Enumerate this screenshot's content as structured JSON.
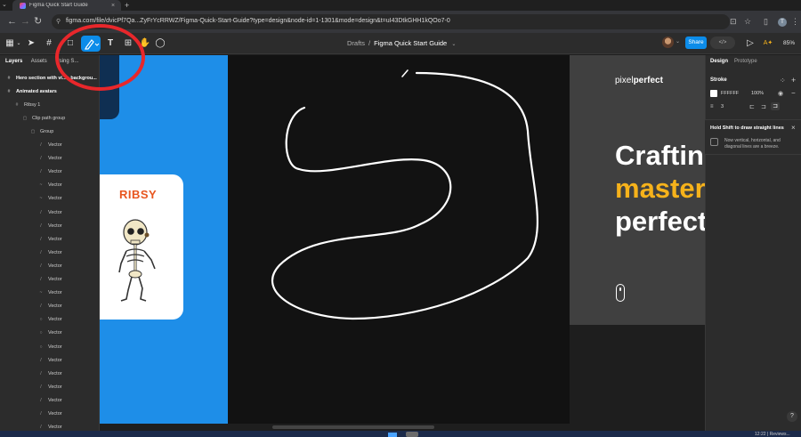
{
  "browser": {
    "tab_title": "Figma Quick Start Guide",
    "url": "figma.com/file/dvicPf7Qa...ZyFrYcRRWZ/Figma-Quick-Start-Guide?type=design&node-id=1-1301&mode=design&t=uI43DtkGHH1kQOo7-0",
    "profile_initial": "T"
  },
  "toolbar": {
    "drafts": "Drafts",
    "separator": "/",
    "file_name": "Figma Quick Start Guide",
    "share_label": "Share",
    "devmode_label": "</>",
    "zoom": "85%"
  },
  "left_panel": {
    "tabs": [
      "Layers",
      "Assets",
      "Using S..."
    ],
    "layers": [
      {
        "label": "Hero section with vi...o backgrou...",
        "indent": 0,
        "bold": true,
        "icon": "#"
      },
      {
        "label": "Animated avatars",
        "indent": 0,
        "bold": true,
        "icon": "#"
      },
      {
        "label": "Ribsy 1",
        "indent": 1,
        "bold": false,
        "icon": "#"
      },
      {
        "label": "Clip path group",
        "indent": 2,
        "bold": false,
        "icon": "▢"
      },
      {
        "label": "Group",
        "indent": 3,
        "bold": false,
        "icon": "▢"
      },
      {
        "label": "Vector",
        "indent": 4,
        "bold": false,
        "icon": "/"
      },
      {
        "label": "Vector",
        "indent": 4,
        "bold": false,
        "icon": "/"
      },
      {
        "label": "Vector",
        "indent": 4,
        "bold": false,
        "icon": "/"
      },
      {
        "label": "Vector",
        "indent": 4,
        "bold": false,
        "icon": "~"
      },
      {
        "label": "Vector",
        "indent": 4,
        "bold": false,
        "icon": "~"
      },
      {
        "label": "Vector",
        "indent": 4,
        "bold": false,
        "icon": "/"
      },
      {
        "label": "Vector",
        "indent": 4,
        "bold": false,
        "icon": "/"
      },
      {
        "label": "Vector",
        "indent": 4,
        "bold": false,
        "icon": "/"
      },
      {
        "label": "Vector",
        "indent": 4,
        "bold": false,
        "icon": "/"
      },
      {
        "label": "Vector",
        "indent": 4,
        "bold": false,
        "icon": "/"
      },
      {
        "label": "Vector",
        "indent": 4,
        "bold": false,
        "icon": "/"
      },
      {
        "label": "Vector",
        "indent": 4,
        "bold": false,
        "icon": "~"
      },
      {
        "label": "Vector",
        "indent": 4,
        "bold": false,
        "icon": "/"
      },
      {
        "label": "Vector",
        "indent": 4,
        "bold": false,
        "icon": "○"
      },
      {
        "label": "Vector",
        "indent": 4,
        "bold": false,
        "icon": "○"
      },
      {
        "label": "Vector",
        "indent": 4,
        "bold": false,
        "icon": "○"
      },
      {
        "label": "Vector",
        "indent": 4,
        "bold": false,
        "icon": "/"
      },
      {
        "label": "Vector",
        "indent": 4,
        "bold": false,
        "icon": "/"
      },
      {
        "label": "Vector",
        "indent": 4,
        "bold": false,
        "icon": "/"
      },
      {
        "label": "Vector",
        "indent": 4,
        "bold": false,
        "icon": "/"
      },
      {
        "label": "Vector",
        "indent": 4,
        "bold": false,
        "icon": "/"
      },
      {
        "label": "Vector",
        "indent": 4,
        "bold": false,
        "icon": "/"
      }
    ]
  },
  "canvas": {
    "card_title": "RIBSY",
    "brand_light": "pixel",
    "brand_bold": "perfect",
    "headline_1": "Crafting",
    "headline_2": "mastery",
    "headline_3": "perfection"
  },
  "right_panel": {
    "tab_design": "Design",
    "tab_prototype": "Prototype",
    "stroke_title": "Stroke",
    "stroke_hex": "FFFFFF",
    "stroke_opacity": "100%",
    "stroke_weight": "3",
    "tip_title": "Hold Shift to draw straight lines",
    "tip_desc": "Now vertical, horizontal, and diagonal lines are a breeze.",
    "help": "?"
  },
  "taskbar": {
    "clock": "12:22 | Reviews..."
  },
  "colors": {
    "accent": "#0c8ce9",
    "canvas_blue": "#1e8ee8",
    "headline_yellow": "#f6b21b",
    "ribsy_orange": "#e8561f",
    "annotation_red": "#e8272b"
  }
}
